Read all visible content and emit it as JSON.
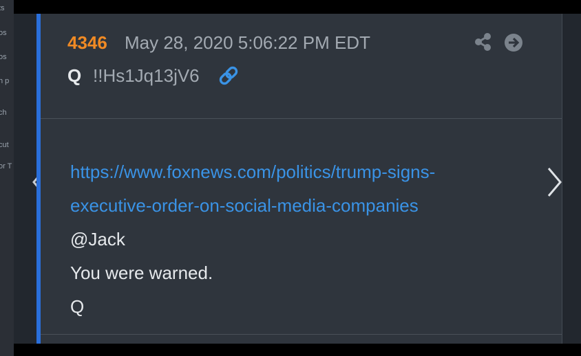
{
  "sidebar": {
    "fragments": [
      "ts",
      "os",
      "os",
      "h p",
      "ch",
      "cut",
      "or T"
    ]
  },
  "post": {
    "number": "4346",
    "date": "May 28, 2020 5:06:22 PM EDT",
    "author": "Q",
    "tripcode": "!!Hs1Jq13jV6",
    "url_line1": "https://www.foxnews.com/politics/trump-signs-",
    "url_line2": "executive-order-on-social-media-companies",
    "lines": [
      "@Jack",
      "You were warned.",
      "Q"
    ]
  },
  "icons": {
    "link": "link-icon",
    "share": "share-icon",
    "go": "arrow-circle-right-icon",
    "prev": "chevron-left-icon",
    "next": "chevron-right-icon"
  },
  "colors": {
    "post_number": "#f08a24",
    "link": "#3a93e6",
    "accent_border": "#2a6fdb",
    "panel_bg": "#2f353d"
  }
}
